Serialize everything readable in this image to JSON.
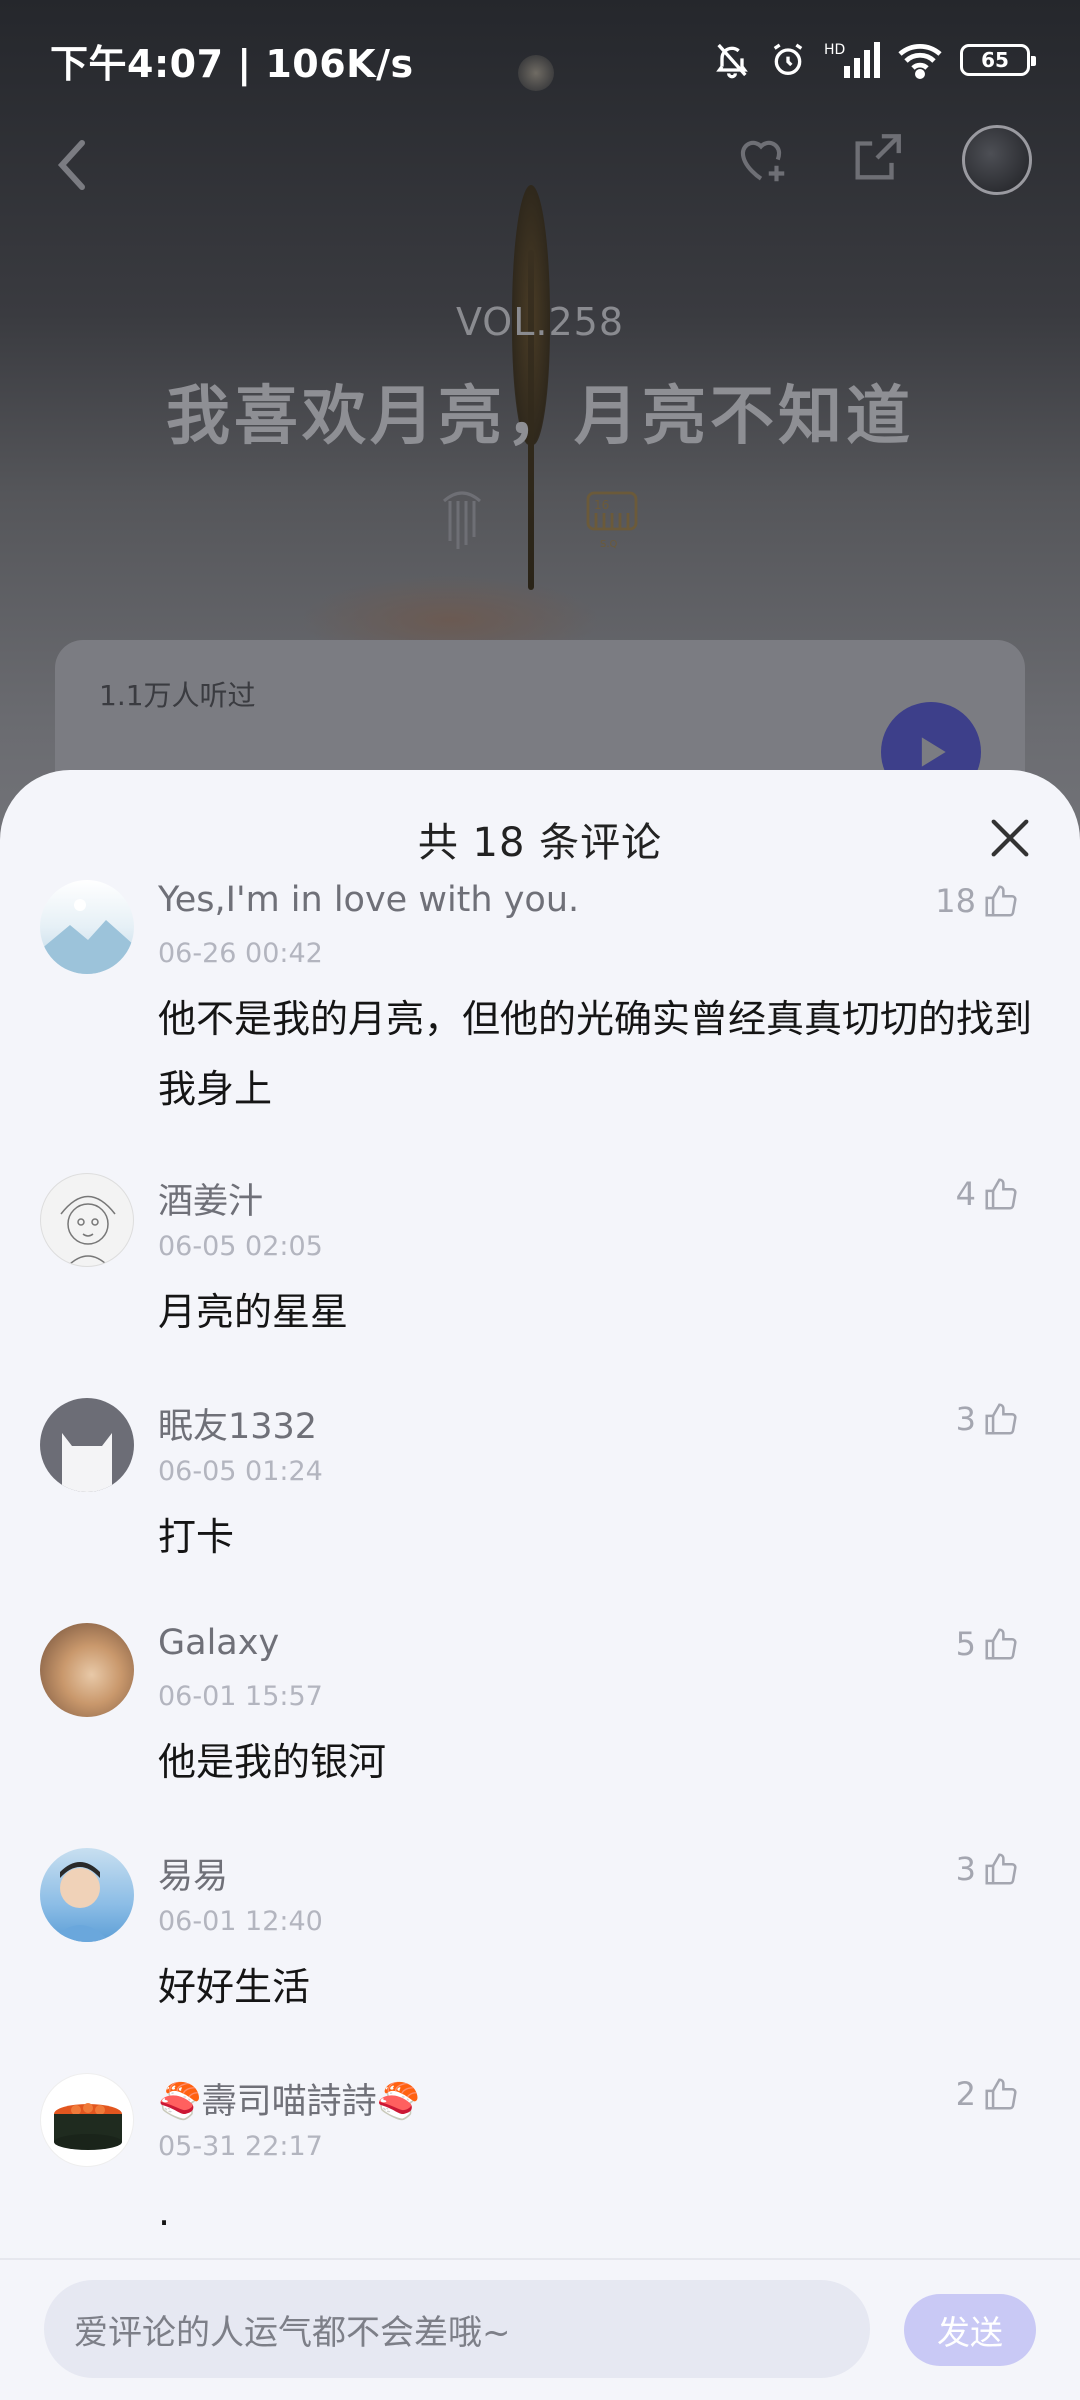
{
  "status_bar": {
    "time": "下午4:07 | 106K/s",
    "battery": "65"
  },
  "player": {
    "vol": "VOL.258",
    "title": "我喜欢月亮，月亮不知道",
    "listened": "1.1万人听过"
  },
  "comments_sheet": {
    "title": "共 18 条评论",
    "comments": [
      {
        "name": "Yes,I'm in love with you.",
        "date": "06-26 00:42",
        "likes": "18",
        "text": "他不是我的月亮，但他的光确实曾经真真切切的找到我身上"
      },
      {
        "name": "酒姜汁",
        "date": "06-05 02:05",
        "likes": "4",
        "text": "月亮的星星"
      },
      {
        "name": "眠友1332",
        "date": "06-05 01:24",
        "likes": "3",
        "text": "打卡"
      },
      {
        "name": "Galaxy",
        "date": "06-01 15:57",
        "likes": "5",
        "text": "他是我的银河"
      },
      {
        "name": "易易",
        "date": "06-01 12:40",
        "likes": "3",
        "text": "好好生活"
      },
      {
        "name": "🍣壽司喵詩詩🍣",
        "date": "05-31 22:17",
        "likes": "2",
        "text": "."
      }
    ]
  },
  "input": {
    "placeholder": "爱评论的人运气都不会差哦~",
    "send_label": "发送"
  },
  "colors": {
    "accent": "#3d3f8a",
    "send_disabled": "#c9c9f5",
    "sheet_bg": "#f4f5fa"
  }
}
